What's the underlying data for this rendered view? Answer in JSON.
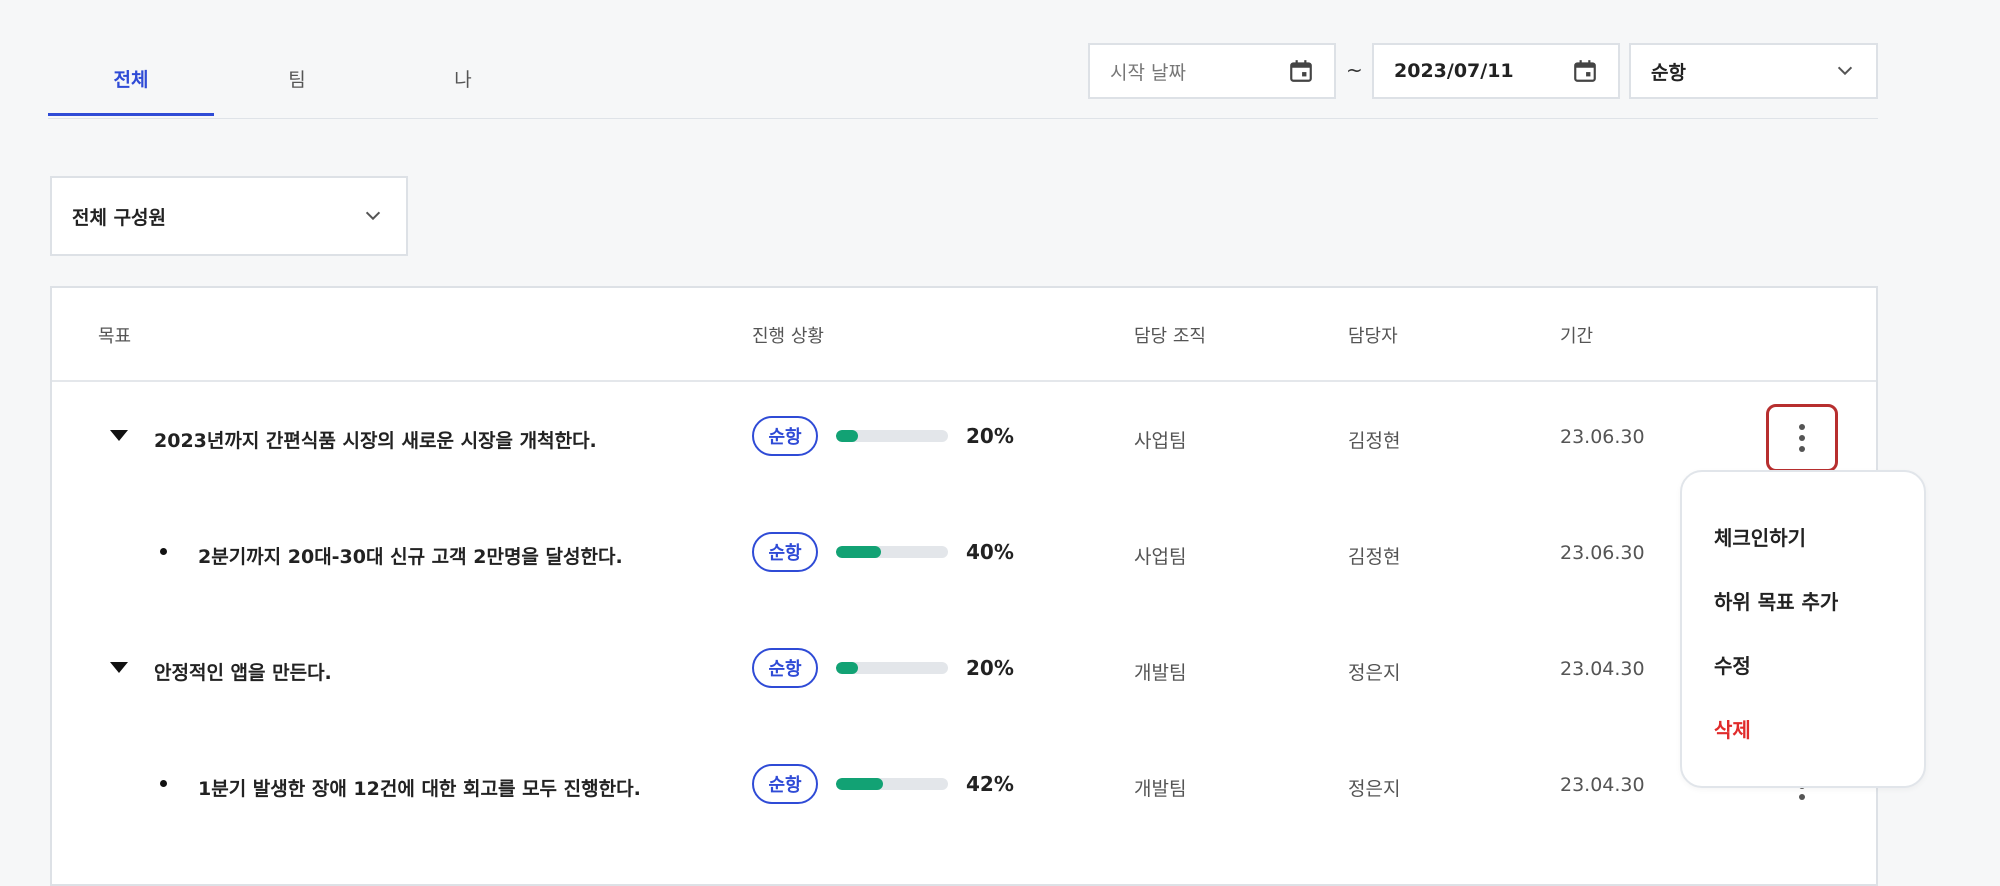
{
  "tabs": [
    {
      "label": "전체",
      "active": true
    },
    {
      "label": "팀",
      "active": false
    },
    {
      "label": "나",
      "active": false
    }
  ],
  "filters": {
    "start_date_placeholder": "시작 날짜",
    "separator": "~",
    "end_date": "2023/07/11",
    "status_select": "순항",
    "member_select": "전체 구성원"
  },
  "table": {
    "headers": {
      "goal": "목표",
      "progress": "진행 상황",
      "org": "담당 조직",
      "owner": "담당자",
      "period": "기간"
    },
    "rows": [
      {
        "goal": "2023년까지 간편식품 시장의 새로운 시장을 개척한다.",
        "level": "parent",
        "status": "순항",
        "progress": 20,
        "progress_label": "20%",
        "org": "사업팀",
        "owner": "김정현",
        "period": "23.06.30"
      },
      {
        "goal": "2분기까지 20대-30대 신규 고객 2만명을 달성한다.",
        "level": "child",
        "status": "순항",
        "progress": 40,
        "progress_label": "40%",
        "org": "사업팀",
        "owner": "김정현",
        "period": "23.06.30"
      },
      {
        "goal": "안정적인 앱을 만든다.",
        "level": "parent",
        "status": "순항",
        "progress": 20,
        "progress_label": "20%",
        "org": "개발팀",
        "owner": "정은지",
        "period": "23.04.30"
      },
      {
        "goal": "1분기 발생한 장애 12건에 대한 회고를 모두 진행한다.",
        "level": "child",
        "status": "순항",
        "progress": 42,
        "progress_label": "42%",
        "org": "개발팀",
        "owner": "정은지",
        "period": "23.04.30"
      }
    ]
  },
  "menu": {
    "items": [
      {
        "label": "체크인하기",
        "danger": false
      },
      {
        "label": "하위 목표 추가",
        "danger": false
      },
      {
        "label": "수정",
        "danger": false
      },
      {
        "label": "삭제",
        "danger": true
      }
    ]
  },
  "colors": {
    "accent": "#2f4bd6",
    "progress": "#12a274",
    "danger": "#e02b2b",
    "highlight": "#b72f2f"
  },
  "icons": [
    "calendar-icon",
    "chevron-down-icon",
    "caret-down-icon",
    "bullet-icon",
    "more-vertical-icon"
  ]
}
